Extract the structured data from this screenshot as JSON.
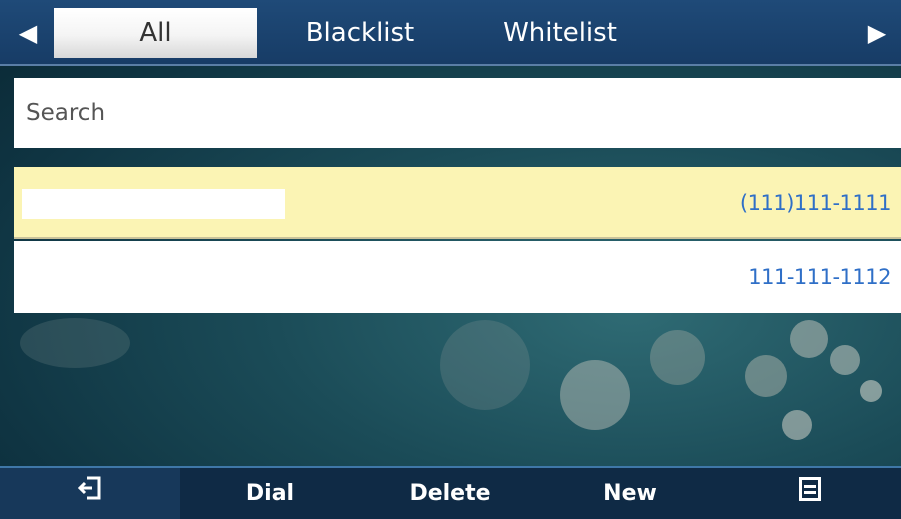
{
  "tabs": {
    "left_arrow": "◀",
    "right_arrow": "▶",
    "items": [
      {
        "label": "All",
        "selected": true
      },
      {
        "label": "Blacklist",
        "selected": false
      },
      {
        "label": "Whitelist",
        "selected": false
      }
    ]
  },
  "search": {
    "placeholder": "Search",
    "value": ""
  },
  "list": {
    "rows": [
      {
        "name": "",
        "number": "(111)111-1111",
        "selected": true
      },
      {
        "name": "",
        "number": "111-111-1112",
        "selected": false
      }
    ]
  },
  "softkeys": {
    "back_icon": "exit-icon",
    "dial": "Dial",
    "delete": "Delete",
    "new": "New",
    "menu_icon": "menu-icon"
  },
  "colors": {
    "tab_bar": "#1f4a78",
    "selected_row": "#fbf4b4",
    "number_text": "#2f6fc7",
    "softkey_bar": "#0f2a45"
  }
}
